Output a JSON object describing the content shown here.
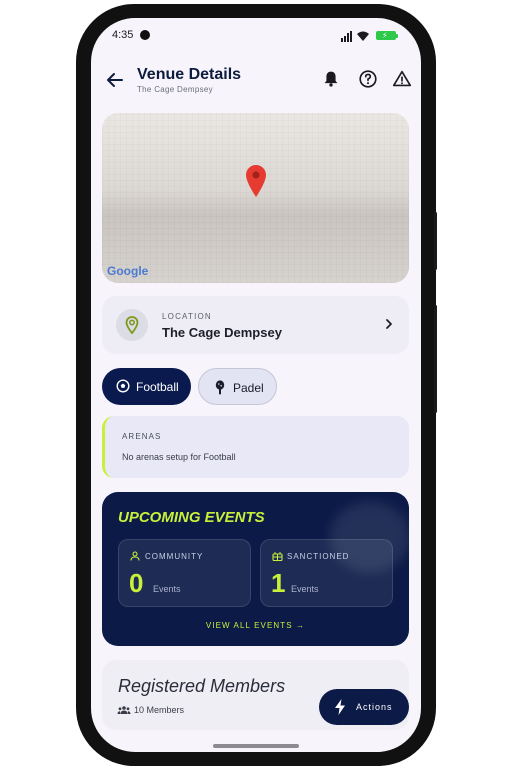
{
  "status_bar": {
    "time": "4:35"
  },
  "header": {
    "title": "Venue Details",
    "subtitle": "The Cage Dempsey",
    "icons": [
      "back-arrow-icon",
      "bell-icon",
      "help-icon",
      "warning-icon"
    ]
  },
  "map": {
    "attribution": "Google",
    "marker_icon": "map-pin-icon"
  },
  "location": {
    "label": "LOCATION",
    "name": "The Cage Dempsey"
  },
  "sports": [
    {
      "label": "Football",
      "icon": "soccer-ball-icon",
      "selected": true
    },
    {
      "label": "Padel",
      "icon": "padel-racket-icon",
      "selected": false
    }
  ],
  "arenas": {
    "label": "ARENAS",
    "empty_text": "No arenas setup for Football"
  },
  "upcoming_events": {
    "title": "UPCOMING EVENTS",
    "community": {
      "label": "COMMUNITY",
      "count": "0",
      "unit": "Events"
    },
    "sanctioned": {
      "label": "SANCTIONED",
      "count": "1",
      "unit": "Events"
    },
    "view_all": "VIEW ALL EVENTS →"
  },
  "members": {
    "title": "Registered Members",
    "count": "10 Members"
  },
  "fab": {
    "label": "Actions"
  },
  "colors": {
    "navy": "#0b1a47",
    "lime": "#c8f03a",
    "background": "#f7f5fb"
  }
}
